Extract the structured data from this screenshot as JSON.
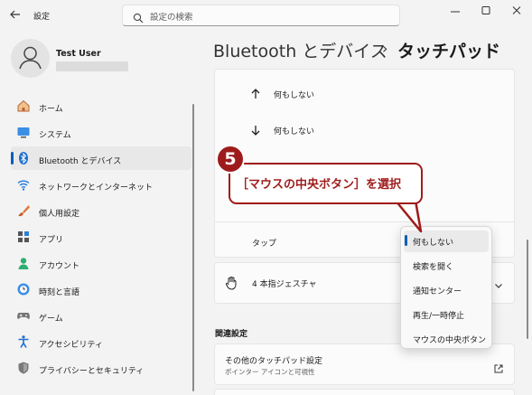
{
  "window": {
    "app_title": "設定",
    "search_placeholder": "設定の検索"
  },
  "user": {
    "name": "Test User"
  },
  "sidebar": {
    "items": [
      {
        "label": "ホーム",
        "icon": "home-icon"
      },
      {
        "label": "システム",
        "icon": "monitor-icon"
      },
      {
        "label": "Bluetooth とデバイス",
        "icon": "bluetooth-icon",
        "active": true
      },
      {
        "label": "ネットワークとインターネット",
        "icon": "wifi-icon"
      },
      {
        "label": "個人用設定",
        "icon": "brush-icon"
      },
      {
        "label": "アプリ",
        "icon": "apps-icon"
      },
      {
        "label": "アカウント",
        "icon": "account-icon"
      },
      {
        "label": "時刻と言語",
        "icon": "clock-globe-icon"
      },
      {
        "label": "ゲーム",
        "icon": "gamepad-icon"
      },
      {
        "label": "アクセシビリティ",
        "icon": "accessibility-icon"
      },
      {
        "label": "プライバシーとセキュリティ",
        "icon": "shield-icon"
      }
    ]
  },
  "header": {
    "parent": "Bluetooth とデバイス",
    "separator": "›",
    "current": "タッチパッド"
  },
  "content": {
    "swipe_up_label": "何もしない",
    "swipe_down_label": "何もしない",
    "tap_label": "タップ",
    "four_finger_label": "4 本指ジェスチャ",
    "related_heading": "関連設定",
    "other_touchpad_title": "その他のタッチパッド設定",
    "other_touchpad_sub": "ポインター アイコンと可視性"
  },
  "dropdown": {
    "options": [
      "何もしない",
      "検索を開く",
      "通知センター",
      "再生/一時停止",
      "マウスの中央ボタン"
    ],
    "selected_index": 0
  },
  "annotation": {
    "step_number": "5",
    "callout_text": "［マウスの中央ボタン］を選択"
  },
  "colors": {
    "accent": "#005fb8",
    "annotation_red": "#9f1b1b"
  }
}
